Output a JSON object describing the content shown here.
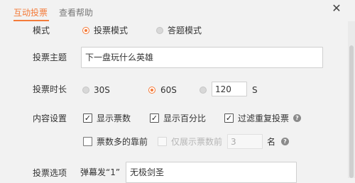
{
  "tabs": [
    {
      "label": "互动投票",
      "active": true
    },
    {
      "label": "查看帮助",
      "active": false
    }
  ],
  "close_icon": "close-icon",
  "form": {
    "mode": {
      "label": "模式",
      "options": [
        {
          "label": "投票模式",
          "selected": true
        },
        {
          "label": "答题模式",
          "selected": false
        }
      ]
    },
    "topic": {
      "label": "投票主题",
      "value": "下一盘玩什么英雄"
    },
    "duration": {
      "label": "投票时长",
      "options": [
        {
          "label": "30S",
          "selected": false
        },
        {
          "label": "60S",
          "selected": true
        }
      ],
      "custom_value": "120",
      "custom_unit": "S"
    },
    "content_settings": {
      "label": "内容设置",
      "row1": [
        {
          "label": "显示票数",
          "checked": true
        },
        {
          "label": "显示百分比",
          "checked": true
        },
        {
          "label": "过滤重复投票",
          "checked": true
        }
      ],
      "row2": {
        "sort_label": "票数多的靠前",
        "sort_checked": false,
        "only_top_label": "仅展示票数前",
        "only_top_checked": false,
        "only_top_value": "3",
        "only_top_unit": "名"
      }
    },
    "vote_options": {
      "label": "投票选项",
      "items": [
        {
          "trigger": "弹幕发“1”",
          "value": "无极剑圣"
        }
      ]
    }
  },
  "colors": {
    "accent": "#f47b3a",
    "background": "#f2f2f2"
  }
}
